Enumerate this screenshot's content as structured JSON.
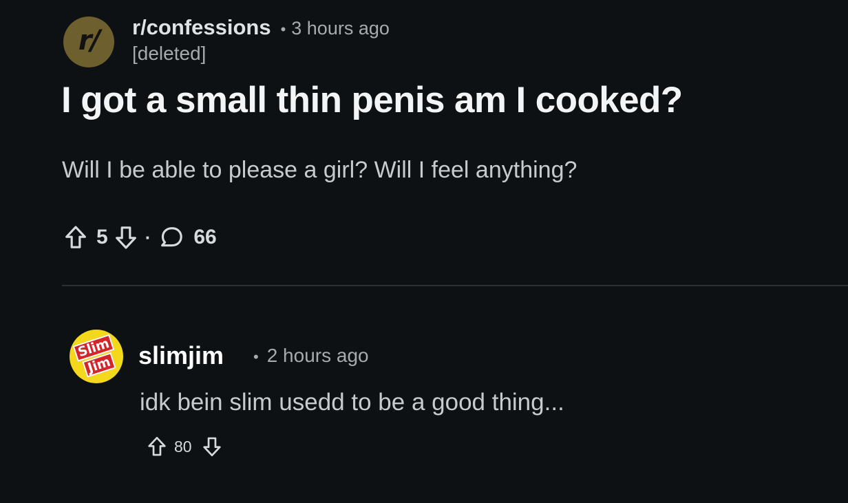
{
  "post": {
    "subreddit_avatar_text": "r/",
    "subreddit": "r/confessions",
    "separator": "•",
    "time": "3 hours ago",
    "author": "[deleted]",
    "title": "I got a small thin penis am I cooked?",
    "body": "Will I be able to please a girl? Will I feel anything?",
    "upvotes": "5",
    "dot": "·",
    "comments": "66"
  },
  "comment": {
    "avatar_text_top": "Slim",
    "avatar_text_bottom": "Jim",
    "username": "slimjim",
    "separator": "•",
    "time": "2 hours ago",
    "text": "idk bein slim usedd to be a good thing...",
    "upvotes": "80"
  },
  "icons": {
    "upvote": "arrow-up-outline-icon",
    "downvote": "arrow-down-outline-icon",
    "comment": "speech-bubble-icon"
  },
  "colors": {
    "background": "#0e1113",
    "subreddit_avatar": "#6e5f2e",
    "comment_avatar": "#f3d81c",
    "logo_red": "#d3252a"
  }
}
